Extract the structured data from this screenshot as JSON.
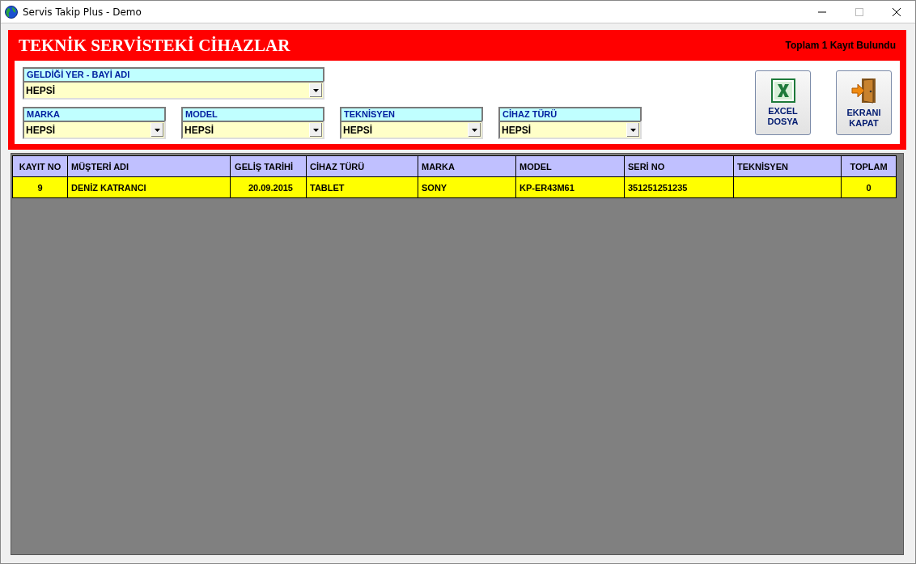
{
  "window": {
    "title": "Servis Takip Plus - Demo"
  },
  "header": {
    "title": "TEKNİK SERVİSTEKİ CİHAZLAR",
    "record_count": "Toplam 1 Kayıt Bulundu"
  },
  "location_filter": {
    "label": "GELDİĞİ YER - BAYİ ADI",
    "value": "HEPSİ"
  },
  "filters": [
    {
      "label": "MARKA",
      "value": "HEPSİ"
    },
    {
      "label": "MODEL",
      "value": "HEPSİ"
    },
    {
      "label": "TEKNİSYEN",
      "value": "HEPSİ"
    },
    {
      "label": "CİHAZ TÜRÜ",
      "value": "HEPSİ"
    }
  ],
  "buttons": [
    {
      "kind": "excel",
      "lines": [
        "EXCEL",
        "DOSYA"
      ]
    },
    {
      "kind": "exit",
      "lines": [
        "EKRANI",
        "KAPAT"
      ]
    }
  ],
  "table": {
    "columns": [
      "KAYIT NO",
      "MÜŞTERİ ADI",
      "GELİŞ TARİHİ",
      "CİHAZ TÜRÜ",
      "MARKA",
      "MODEL",
      "SERİ NO",
      "TEKNİSYEN",
      "TOPLAM"
    ],
    "rows": [
      {
        "selected": true,
        "cells": [
          "9",
          "DENİZ KATRANCI",
          "20.09.2015",
          "TABLET",
          "SONY",
          "KP-ER43M61",
          "351251251235",
          "",
          "0"
        ]
      }
    ]
  }
}
